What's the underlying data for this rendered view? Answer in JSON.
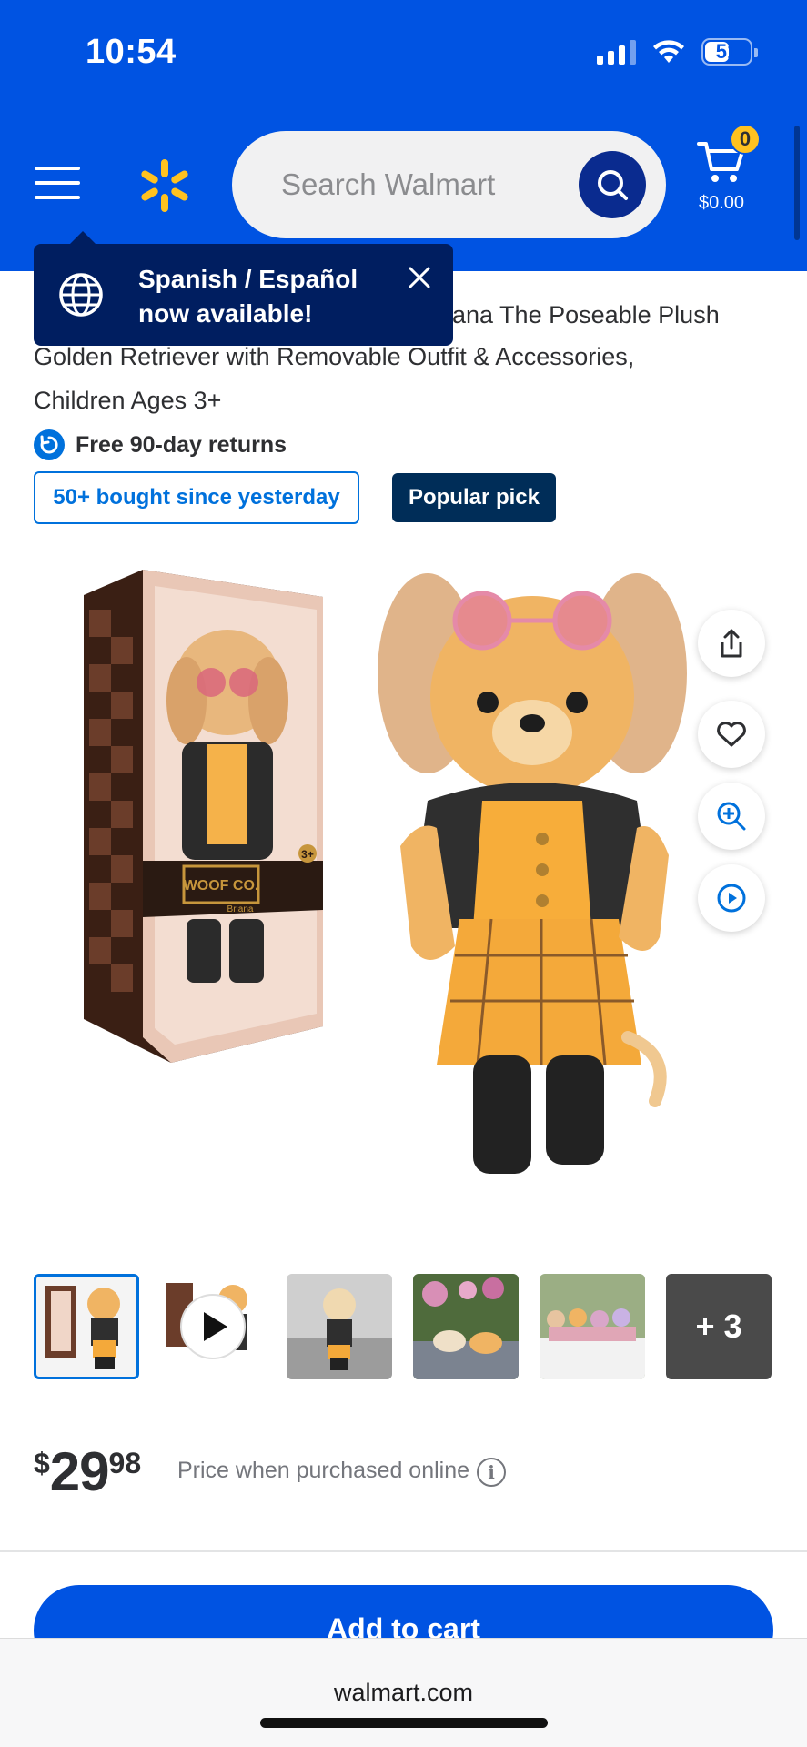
{
  "status_bar": {
    "time": "10:54",
    "battery": "51"
  },
  "header": {
    "search_placeholder": "Search Walmart",
    "cart_count": "0",
    "cart_total": "$0.00"
  },
  "toast": {
    "message": "Spanish / Español now available!"
  },
  "product": {
    "title_visible_line1": "ana The Poseable Plush",
    "title_line2": "Golden Retriever with Removable Outfit & Accessories,",
    "title_line3": "Children Ages 3+",
    "returns": "Free 90-day returns",
    "badge_bought": "50+ bought since yesterday",
    "badge_popular": "Popular pick",
    "box_brand": "WOOF CO.",
    "box_age": "3+",
    "box_name": "Briana",
    "thumbnails_more": "+ 3",
    "price_currency": "$",
    "price_dollars": "29",
    "price_cents": "98",
    "price_note": "Price when purchased online",
    "add_to_cart": "Add to cart"
  },
  "browser": {
    "url": "walmart.com"
  },
  "colors": {
    "walmart_blue": "#0053e2",
    "spark_yellow": "#ffc220",
    "navy": "#001e60"
  }
}
